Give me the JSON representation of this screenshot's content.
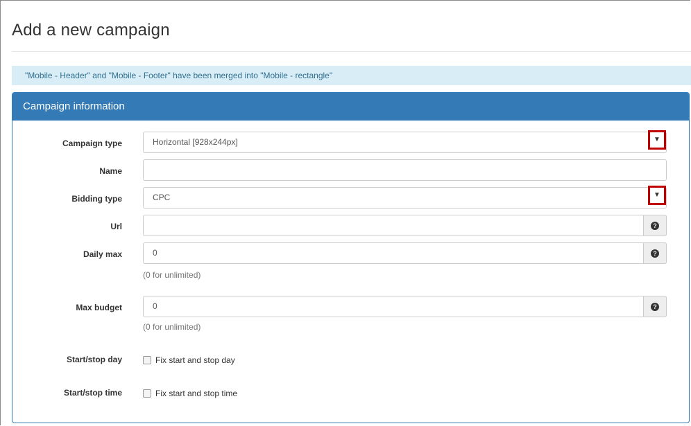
{
  "page": {
    "title": "Add a new campaign",
    "alert": "\"Mobile - Header\" and \"Mobile - Footer\" have been merged into \"Mobile - rectangle\""
  },
  "panel": {
    "heading": "Campaign information"
  },
  "form": {
    "campaign_type": {
      "label": "Campaign type",
      "value": "Horizontal [928x244px]"
    },
    "name": {
      "label": "Name",
      "value": ""
    },
    "bidding_type": {
      "label": "Bidding type",
      "value": "CPC"
    },
    "url": {
      "label": "Url",
      "value": ""
    },
    "daily_max": {
      "label": "Daily max",
      "value": "0",
      "hint": "(0 for unlimited)"
    },
    "max_budget": {
      "label": "Max budget",
      "value": "0",
      "hint": "(0 for unlimited)"
    },
    "start_stop_day": {
      "label": "Start/stop day",
      "checkbox_label": "Fix start and stop day",
      "checked": false
    },
    "start_stop_time": {
      "label": "Start/stop time",
      "checkbox_label": "Fix start and stop time",
      "checked": false
    }
  },
  "icons": {
    "dropdown": "caret-down-icon",
    "help": "question-circle-icon"
  },
  "colors": {
    "primary": "#337ab7",
    "alert_bg": "#d9edf7",
    "alert_text": "#31708f",
    "highlight_border": "#c00000"
  }
}
